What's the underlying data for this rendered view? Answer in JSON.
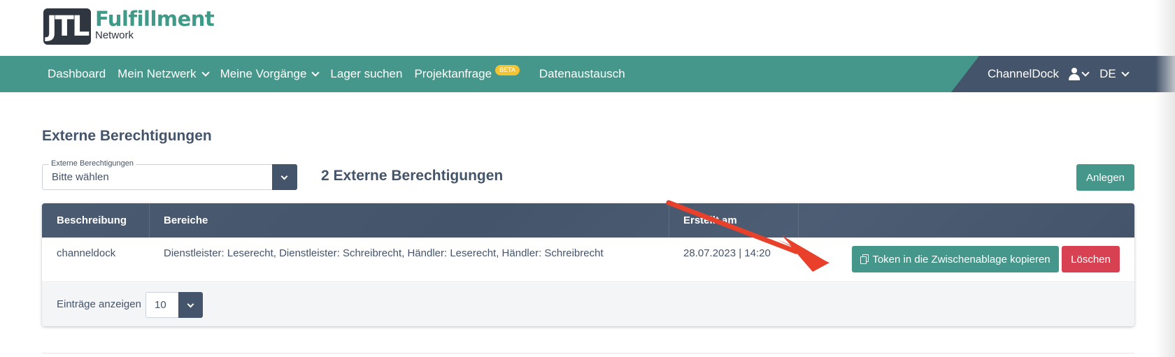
{
  "logo": {
    "mark": "JTL",
    "title": "Fulfillment",
    "subtitle": "Network"
  },
  "nav": {
    "items": [
      {
        "label": "Dashboard",
        "dropdown": false
      },
      {
        "label": "Mein Netzwerk",
        "dropdown": true
      },
      {
        "label": "Meine Vorgänge",
        "dropdown": true
      },
      {
        "label": "Lager suchen",
        "dropdown": false
      },
      {
        "label": "Projektanfrage",
        "badge": "BETA"
      },
      {
        "label": "Datenaustausch",
        "dropdown": false
      }
    ],
    "account": "ChannelDock",
    "language": "DE"
  },
  "page": {
    "title": "Externe Berechtigungen",
    "filter": {
      "label": "Externe Berechtigungen",
      "value": "Bitte wählen"
    },
    "count_title": "2 Externe Berechtigungen",
    "create_button": "Anlegen"
  },
  "table": {
    "headers": [
      "Beschreibung",
      "Bereiche",
      "Erstellt am"
    ],
    "rows": [
      {
        "beschreibung": "channeldock",
        "bereiche": "Dienstleister: Leserecht, Dienstleister: Schreibrecht, Händler: Leserecht, Händler: Schreibrecht",
        "erstellt_am": "28.07.2023 | 14:20",
        "copy_button": "Token in die Zwischenablage kopieren",
        "delete_button": "Löschen"
      }
    ],
    "footer": {
      "label": "Einträge anzeigen",
      "page_size": "10"
    }
  },
  "colors": {
    "teal": "#44978a",
    "slate": "#44546a",
    "danger": "#d84152",
    "badge": "#f4c430",
    "annotation": "#e8402a"
  },
  "icons": [
    "user-icon",
    "copy-icon",
    "chevron-down-icon"
  ]
}
